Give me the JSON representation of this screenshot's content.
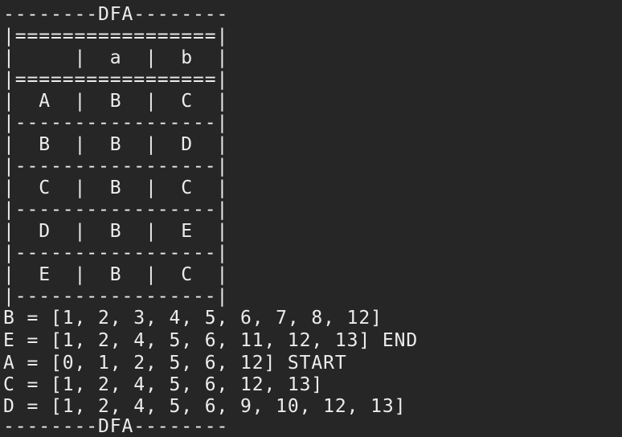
{
  "terminal": {
    "lines": [
      "--------DFA--------",
      "|=================|",
      "|     |  a  |  b  |",
      "|=================|",
      "|  A  |  B  |  C  |",
      "|-----------------|",
      "|  B  |  B  |  D  |",
      "|-----------------|",
      "|  C  |  B  |  C  |",
      "|-----------------|",
      "|  D  |  B  |  E  |",
      "|-----------------|",
      "|  E  |  B  |  C  |",
      "|-----------------|",
      "B = [1, 2, 3, 4, 5, 6, 7, 8, 12]",
      "E = [1, 2, 4, 5, 6, 11, 12, 13] END",
      "A = [0, 1, 2, 5, 6, 12] START",
      "C = [1, 2, 4, 5, 6, 12, 13]",
      "D = [1, 2, 4, 5, 6, 9, 10, 12, 13]",
      "--------DFA--------"
    ]
  }
}
